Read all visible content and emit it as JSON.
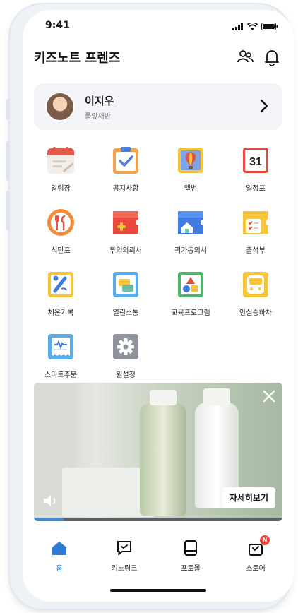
{
  "status": {
    "time": "9:41"
  },
  "header": {
    "title": "키즈노트 프렌즈",
    "icons": [
      "people-icon",
      "bell-icon"
    ]
  },
  "profile": {
    "name": "이지우",
    "class": "풀잎새반"
  },
  "menu": [
    {
      "label": "알림장",
      "icon": "notebook-icon"
    },
    {
      "label": "공지사항",
      "icon": "checkbox-clipboard-icon"
    },
    {
      "label": "앨범",
      "icon": "balloon-album-icon"
    },
    {
      "label": "일정표",
      "icon": "calendar-icon",
      "calendar_day": "31"
    },
    {
      "label": "식단표",
      "icon": "utensils-icon"
    },
    {
      "label": "투약의뢰서",
      "icon": "medicine-ticket-icon"
    },
    {
      "label": "귀가동의서",
      "icon": "house-ticket-icon"
    },
    {
      "label": "출석부",
      "icon": "attendance-icon"
    },
    {
      "label": "체온기록",
      "icon": "thermometer-icon"
    },
    {
      "label": "열린소통",
      "icon": "chat-board-icon"
    },
    {
      "label": "교육프로그램",
      "icon": "shapes-icon"
    },
    {
      "label": "안심승하차",
      "icon": "bus-icon"
    },
    {
      "label": "스마트주문",
      "icon": "receipt-icon"
    },
    {
      "label": "원설정",
      "icon": "gear-icon"
    }
  ],
  "banner": {
    "cta": "자세히보기",
    "icons": [
      "close-icon",
      "volume-icon"
    ],
    "progress": 0.12
  },
  "tabs": [
    {
      "label": "홈",
      "icon": "home-icon",
      "active": true
    },
    {
      "label": "키노링크",
      "icon": "link-chat-icon"
    },
    {
      "label": "포토몰",
      "icon": "photo-book-icon"
    },
    {
      "label": "스토어",
      "icon": "store-bag-icon",
      "badge": "N"
    }
  ],
  "colors": {
    "accent": "#2f7bd8",
    "badge": "#e5483b",
    "card_bg": "#f2f4f8"
  }
}
